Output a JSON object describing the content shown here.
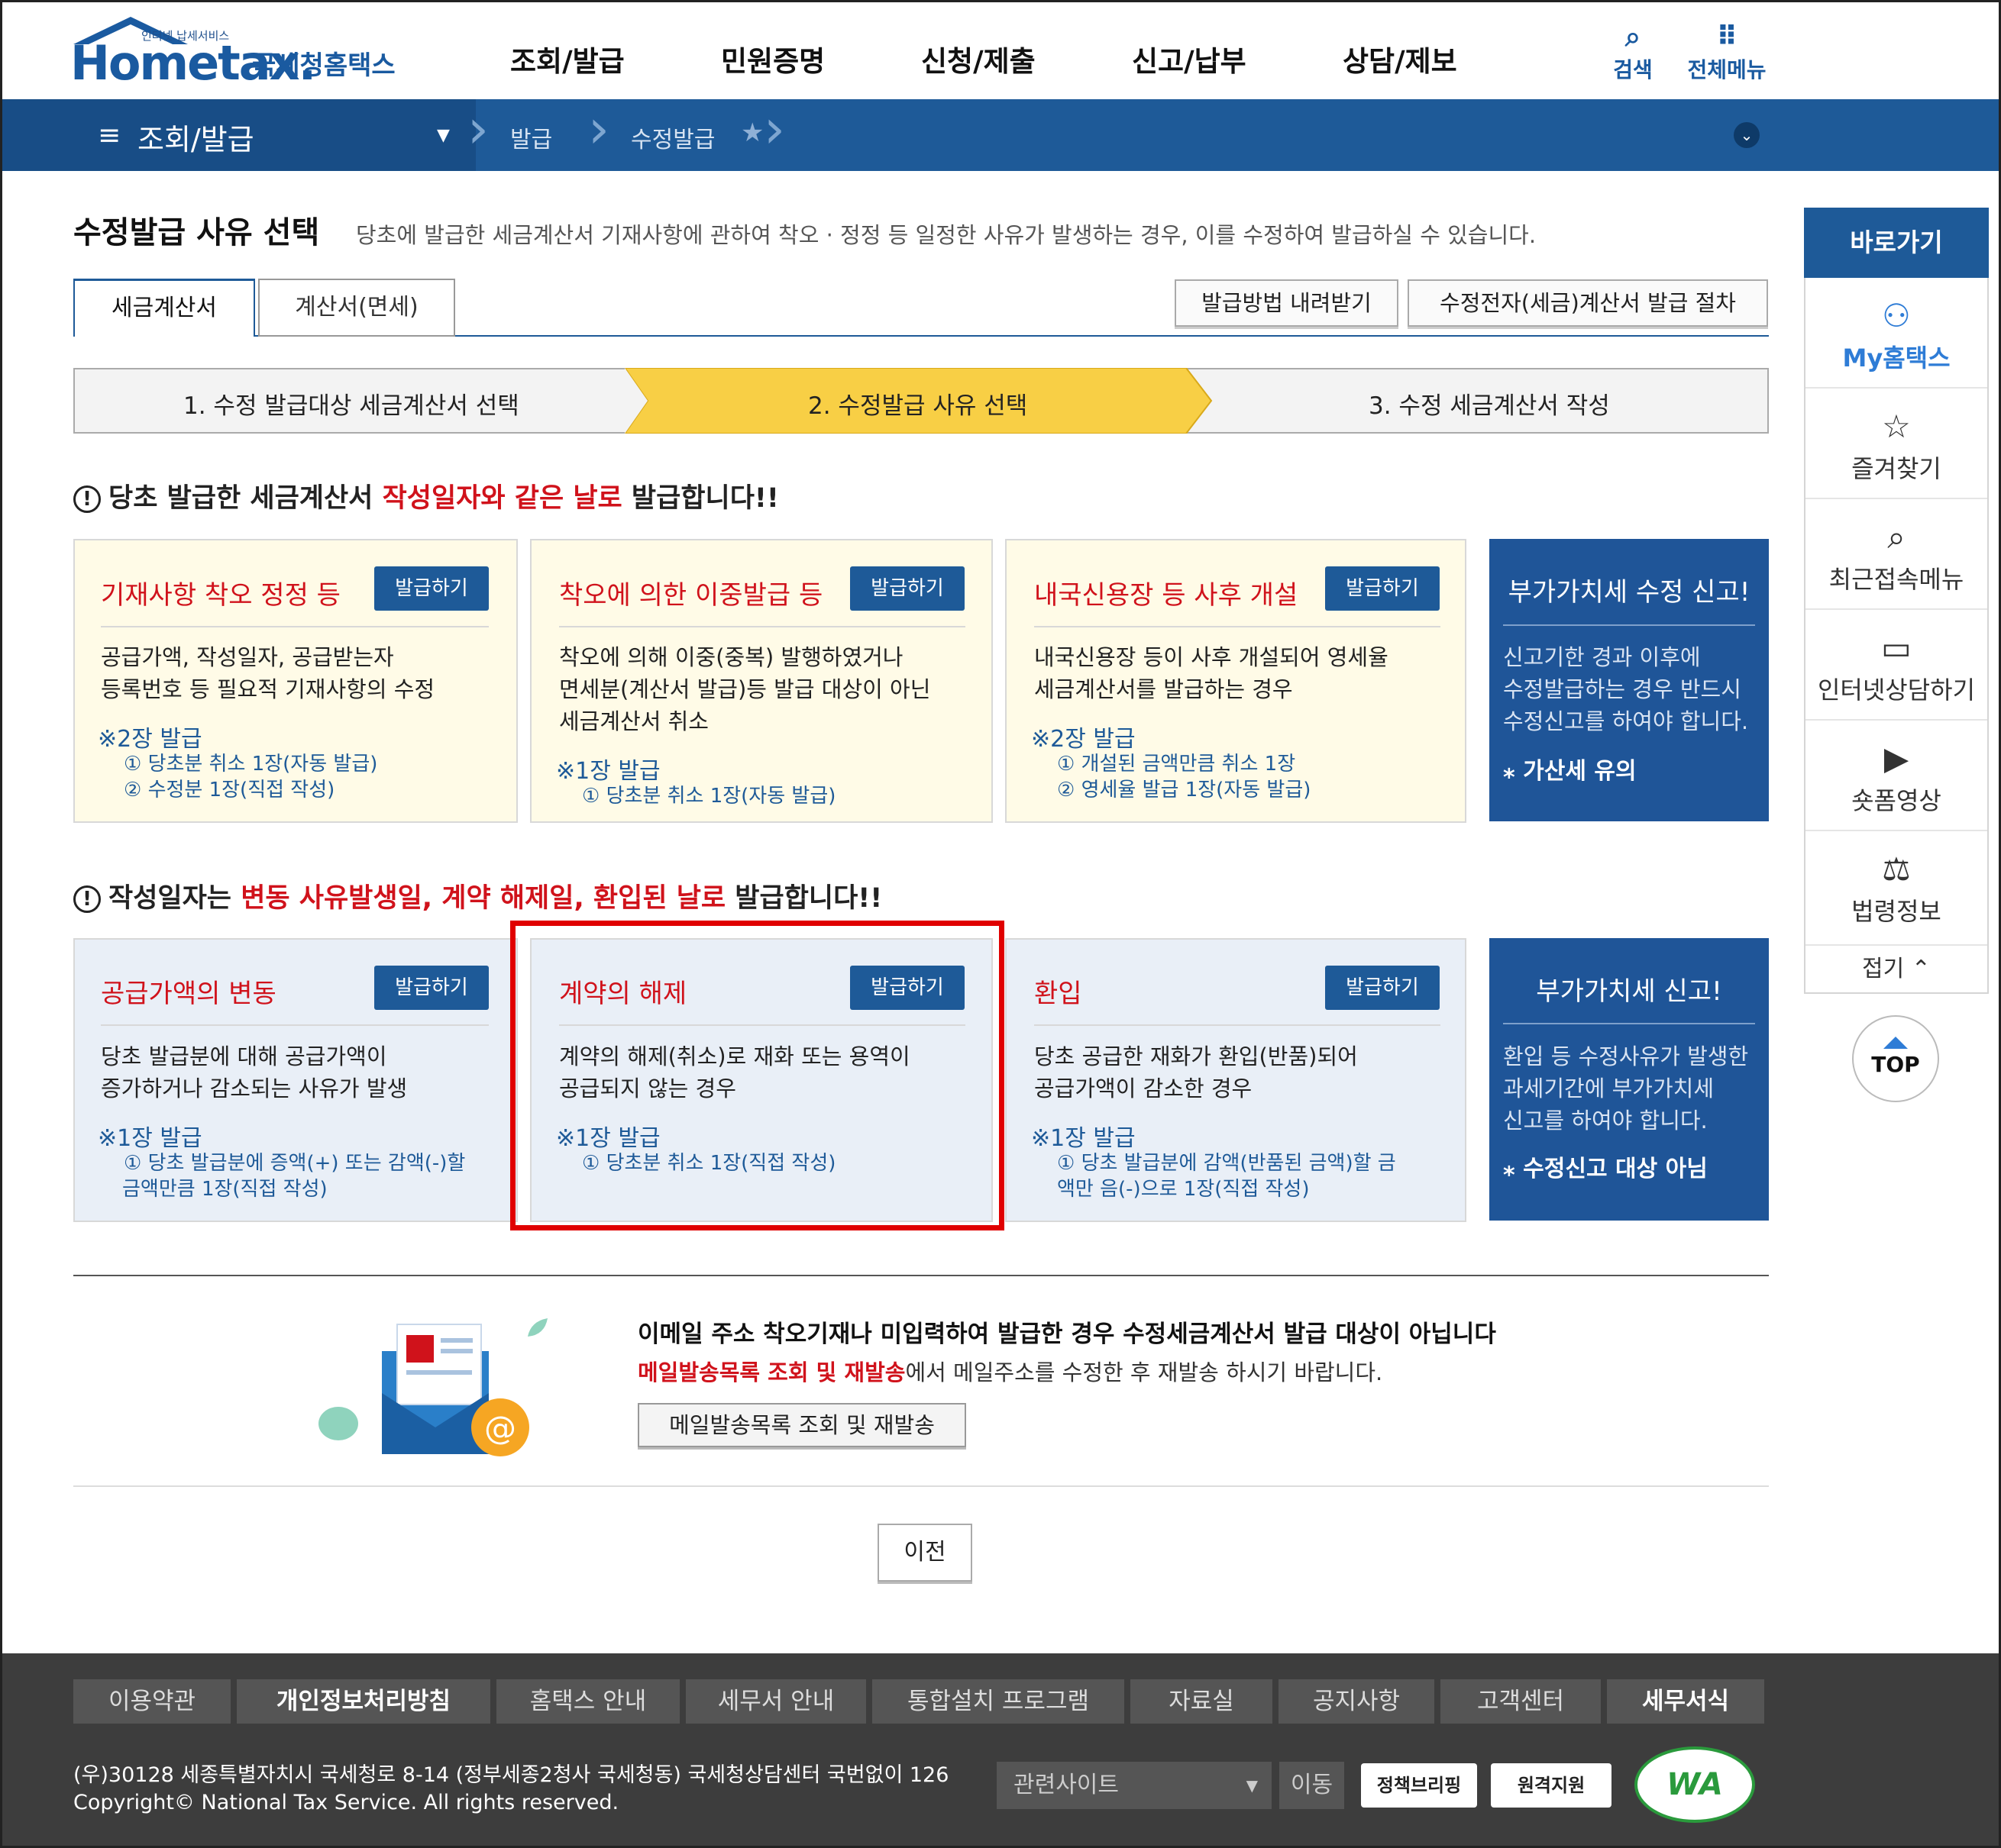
{
  "header": {
    "logo_small": "인터넷 납세서비스",
    "logo_main": "Hometax.",
    "logo_kr": "국세청홈택스",
    "nav": [
      "조회/발급",
      "민원증명",
      "신청/제출",
      "신고/납부",
      "상담/제보"
    ],
    "search_label": "검색",
    "allmenu_label": "전체메뉴"
  },
  "subbar": {
    "menu_title": "조회/발급",
    "breadcrumb": [
      "발급",
      "수정발급"
    ]
  },
  "quick": {
    "title": "바로가기",
    "items": [
      "My홈택스",
      "즐겨찾기",
      "최근접속메뉴",
      "인터넷상담하기",
      "숏폼영상",
      "법령정보"
    ],
    "fold": "접기",
    "top": "TOP"
  },
  "page": {
    "title": "수정발급 사유 선택",
    "desc": "당초에 발급한 세금계산서 기재사항에 관하여 착오 · 정정 등 일정한 사유가 발생하는 경우, 이를 수정하여 발급하실 수 있습니다.",
    "tabs": [
      "세금계산서",
      "계산서(면세)"
    ],
    "btn_download": "발급방법 내려받기",
    "btn_procedure": "수정전자(세금)계산서 발급 절차",
    "steps": [
      "1. 수정 발급대상 세금계산서 선택",
      "2. 수정발급 사유 선택",
      "3. 수정 세금계산서 작성"
    ]
  },
  "notice1": {
    "pre": "당초 발급한 세금계산서 ",
    "red": "작성일자와 같은 날로",
    "post": " 발급합니다!!"
  },
  "notice2": {
    "pre": "작성일자는 ",
    "red": "변동 사유발생일, 계약 해제일, 환입된 날로",
    "post": " 발급합니다!!"
  },
  "issue_btn": "발급하기",
  "cards1": [
    {
      "title": "기재사항 착오 정정 등",
      "body": [
        "공급가액, 작성일자, 공급받는자",
        "등록번호 등 필요적 기재사항의 수정"
      ],
      "count": "※2장 발급",
      "subs": [
        "① 당초분 취소 1장(자동 발급)",
        "② 수정분 1장(직접 작성)"
      ]
    },
    {
      "title": "착오에 의한 이중발급 등",
      "body": [
        "착오에 의해 이중(중복) 발행하였거나",
        "면세분(계산서 발급)등 발급 대상이 아닌",
        "세금계산서 취소"
      ],
      "count": "※1장 발급",
      "subs": [
        "① 당초분 취소 1장(자동 발급)"
      ]
    },
    {
      "title": "내국신용장 등 사후 개설",
      "body": [
        "내국신용장 등이 사후 개설되어 영세율",
        "세금계산서를 발급하는 경우"
      ],
      "count": "※2장 발급",
      "subs": [
        "① 개설된 금액만큼 취소 1장",
        "② 영세율 발급 1장(자동 발급)"
      ]
    }
  ],
  "dark1": {
    "title": "부가가치세 수정 신고!",
    "body": [
      "신고기한 경과 이후에",
      "수정발급하는 경우 반드시",
      "수정신고를 하여야 합니다."
    ],
    "foot": "가산세 유의"
  },
  "cards2": [
    {
      "title": "공급가액의 변동",
      "body": [
        "당초 발급분에 대해 공급가액이",
        "증가하거나 감소되는 사유가 발생"
      ],
      "count": "※1장 발급",
      "subs": [
        "① 당초 발급분에 증액(+) 또는 감액(-)할",
        "금액만큼 1장(직접 작성)"
      ]
    },
    {
      "title": "계약의 해제",
      "body": [
        "계약의 해제(취소)로 재화 또는 용역이",
        "공급되지 않는 경우"
      ],
      "count": "※1장 발급",
      "subs": [
        "① 당초분 취소 1장(직접 작성)"
      ]
    },
    {
      "title": "환입",
      "body": [
        "당초 공급한 재화가 환입(반품)되어",
        "공급가액이 감소한 경우"
      ],
      "count": "※1장 발급",
      "subs": [
        "① 당초 발급분에 감액(반품된 금액)할 금",
        "액만 음(-)으로 1장(직접 작성)"
      ]
    }
  ],
  "dark2": {
    "title": "부가가치세 신고!",
    "body": [
      "환입 등 수정사유가 발생한",
      "과세기간에 부가가치세",
      "신고를 하여야 합니다."
    ],
    "foot": "수정신고 대상 아님"
  },
  "mail": {
    "title": "이메일 주소 착오기재나 미입력하여 발급한 경우 수정세금계산서 발급 대상이 아닙니다",
    "desc_red": "메일발송목록 조회 및 재발송",
    "desc_rest": "에서 메일주소를 수정한 후 재발송 하시기 바랍니다.",
    "button": "메일발송목록 조회 및 재발송"
  },
  "prev_btn": "이전",
  "footer": {
    "links": [
      "이용약관",
      "개인정보처리방침",
      "홈택스 안내",
      "세무서 안내",
      "통합설치 프로그램",
      "자료실",
      "공지사항",
      "고객센터",
      "세무서식"
    ],
    "address": "(우)30128 세종특별자치시 국세청로 8-14 (정부세종2청사 국세청동) 국세청상담센터 국번없이 126",
    "copyright": "Copyright© National Tax Service. All rights reserved.",
    "related_site": "관련사이트",
    "move": "이동",
    "badge1": "정책브리핑",
    "badge2": "원격지원",
    "wa": "WA"
  },
  "colors": {
    "brand_blue": "#1e5a98",
    "red": "#d0121b",
    "highlight": "#e00000"
  }
}
